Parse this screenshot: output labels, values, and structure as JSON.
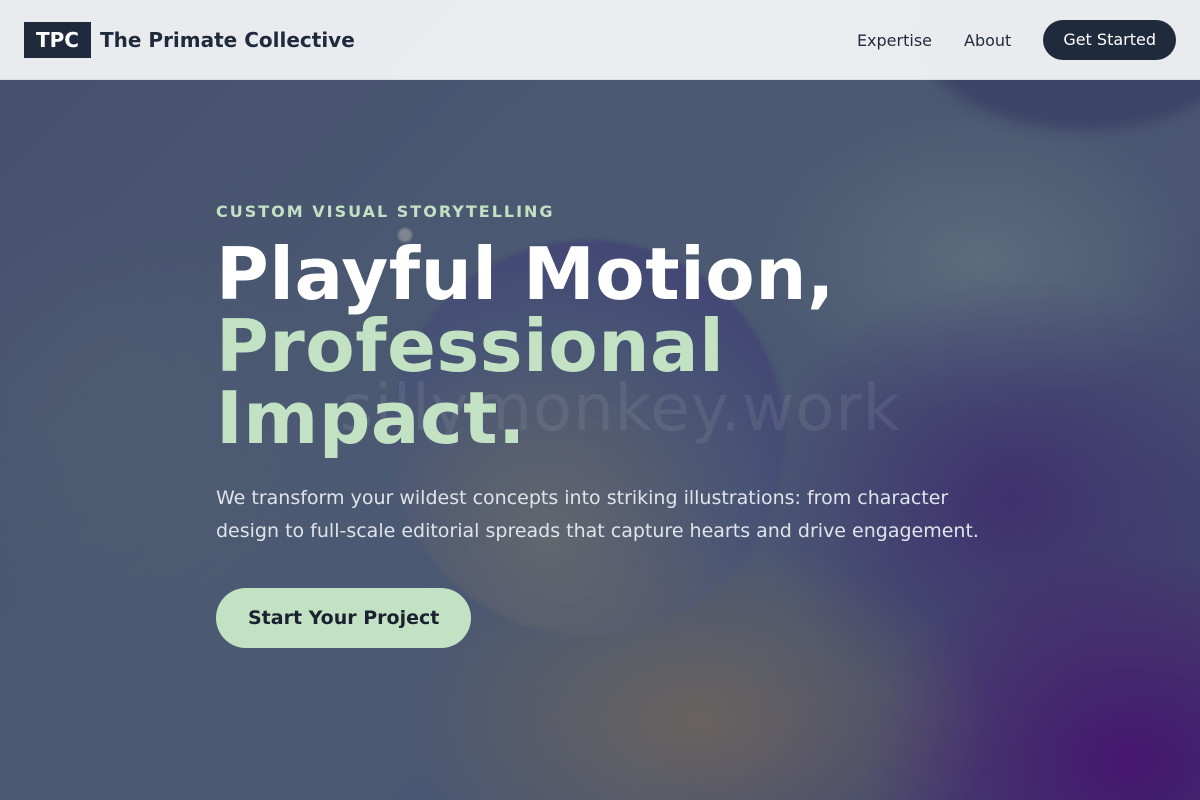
{
  "header": {
    "logo_text": "TPC",
    "brand_name": "The Primate Collective",
    "nav": [
      {
        "label": "Expertise"
      },
      {
        "label": "About"
      }
    ],
    "cta_label": "Get Started"
  },
  "hero": {
    "watermark": "sillymonkey.work",
    "eyebrow": "CUSTOM VISUAL STORYTELLING",
    "headline_line1": "Playful Motion,",
    "headline_line2": "Professional",
    "headline_line3": "Impact.",
    "lead": "We transform your wildest concepts into striking illustrations: from character design to full-scale editorial spreads that capture hearts and drive engagement.",
    "cta_label": "Start Your Project"
  },
  "colors": {
    "navy": "#1f2a3d",
    "mint": "#c3e2c4",
    "header_bg": "#f0f1f4"
  }
}
